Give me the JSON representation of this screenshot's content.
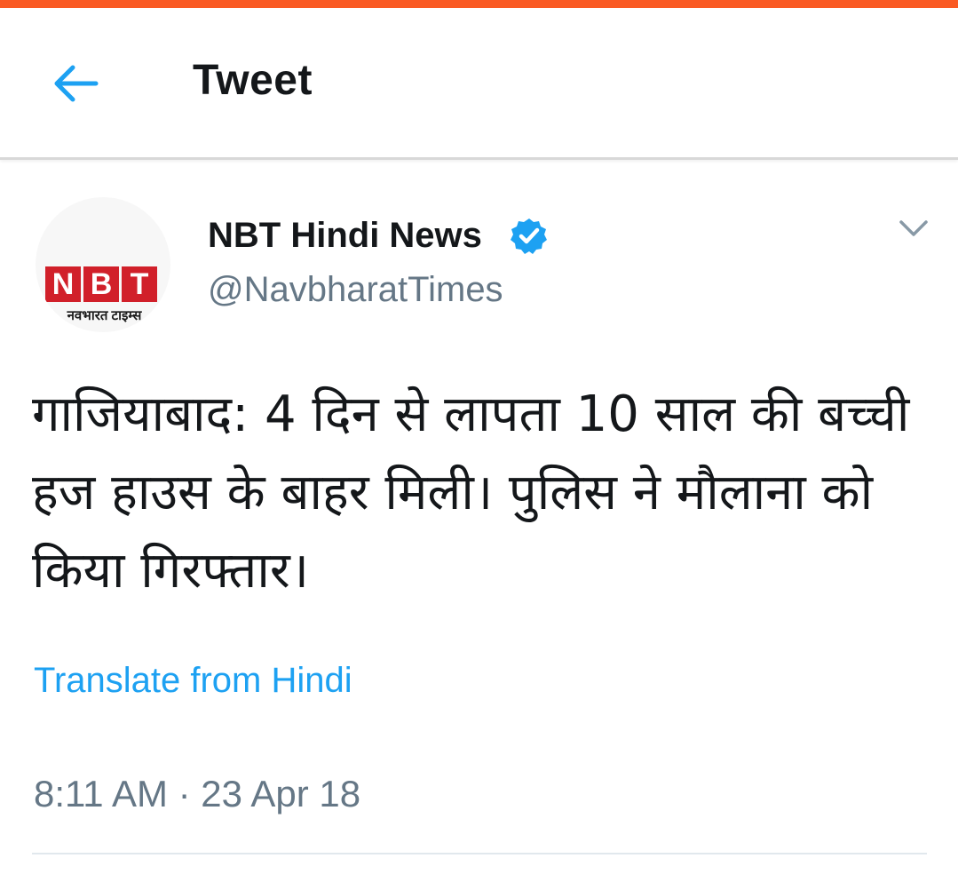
{
  "colors": {
    "accent": "#fa5a23",
    "link": "#1da1f2",
    "text": "#14171a",
    "muted": "#657786",
    "verified": "#1da1f2",
    "logo_red": "#d1202a"
  },
  "appbar": {
    "back_icon": "arrow-left-icon",
    "title": "Tweet"
  },
  "tweet": {
    "avatar": {
      "logo_letters": [
        "N",
        "B",
        "T"
      ],
      "logo_subtitle": "नवभारत टाइम्स"
    },
    "display_name": "NBT Hindi News",
    "verified_icon": "verified-badge-icon",
    "handle": "@NavbharatTimes",
    "menu_icon": "chevron-down-icon",
    "text": "गाजियाबाद: 4 दिन से लापता 10 साल की बच्ची हज हाउस के बाहर मिली। पुलिस ने मौलाना को किया गिरफ्तार।",
    "translate_label": "Translate from Hindi",
    "timestamp": "8:11 AM · 23 Apr 18"
  }
}
